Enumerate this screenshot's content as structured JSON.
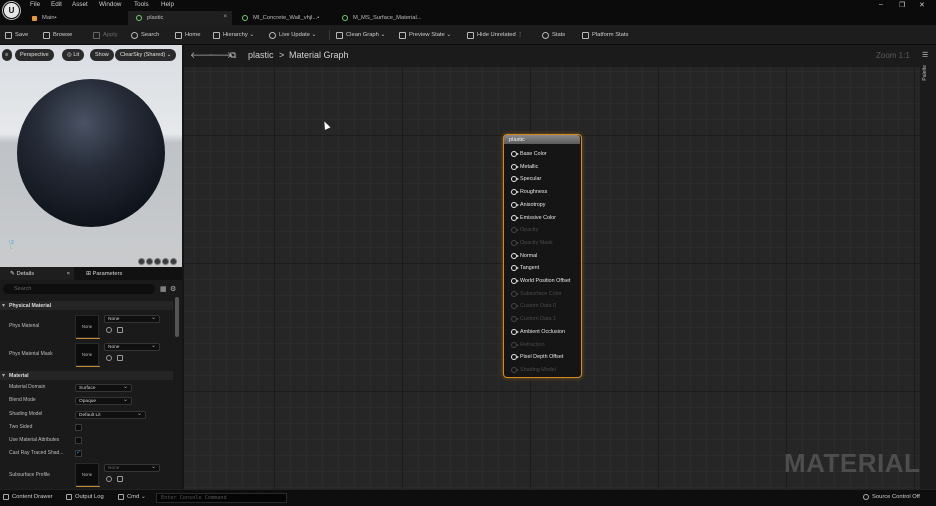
{
  "menu": {
    "items": [
      "File",
      "Edit",
      "Asset",
      "Window",
      "Tools",
      "Help"
    ],
    "window_controls": [
      "–",
      "❐",
      "✕"
    ]
  },
  "tabs": [
    {
      "label": "Main•",
      "icon": "level-icon"
    },
    {
      "label": "plastic",
      "icon": "material-icon",
      "close": "×"
    },
    {
      "label": "MI_Concrete_Wall_vhjl...•",
      "icon": "material-instance-icon"
    },
    {
      "label": "M_MS_Surface_Material...",
      "icon": "material-icon"
    }
  ],
  "toolbar": {
    "save": "Save",
    "browse": "Browse",
    "apply": "Apply",
    "search": "Search",
    "home": "Home",
    "hierarchy": "Hierarchy",
    "live_update": "Live Update",
    "clean_graph": "Clean Graph",
    "preview_state": "Preview State",
    "hide_unrelated": "Hide Unrelated",
    "stats": "Stats",
    "platform_stats": "Platform Stats"
  },
  "viewport": {
    "perspective": "Perspective",
    "lit": "Lit",
    "show": "Show",
    "sky": "ClearSky (Shared)"
  },
  "details": {
    "tab_details": "Details",
    "tab_close": "×",
    "tab_parameters": "Parameters",
    "search_placeholder": "Search",
    "section_physical": "Physical Material",
    "phys_material_label": "Phys Material",
    "phys_material_value": "None",
    "phys_material_thumb": "None",
    "phys_mask_label": "Phys Material Mask",
    "phys_mask_value": "None",
    "phys_mask_thumb": "None",
    "section_material": "Material",
    "material_domain_label": "Material Domain",
    "material_domain_value": "Surface",
    "blend_mode_label": "Blend Mode",
    "blend_mode_value": "Opaque",
    "shading_model_label": "Shading Model",
    "shading_model_value": "Default Lit",
    "two_sided_label": "Two Sided",
    "use_material_attributes_label": "Use Material Attributes",
    "cast_ray_traced_label": "Cast Ray Traced Shad...",
    "subsurface_profile_label": "Subsurface Profile",
    "subsurface_profile_value": "None",
    "subsurface_thumb": "None"
  },
  "graph": {
    "breadcrumb_asset": "plastic",
    "breadcrumb_sep": ">",
    "breadcrumb_graph": "Material Graph",
    "zoom": "Zoom 1:1",
    "watermark": "MATERIAL",
    "palette": "Palette"
  },
  "node": {
    "title": "plastic",
    "pins": [
      {
        "label": "Base Color",
        "enabled": true
      },
      {
        "label": "Metallic",
        "enabled": true
      },
      {
        "label": "Specular",
        "enabled": true
      },
      {
        "label": "Roughness",
        "enabled": true
      },
      {
        "label": "Anisotropy",
        "enabled": true
      },
      {
        "label": "Emissive Color",
        "enabled": true
      },
      {
        "label": "Opacity",
        "enabled": false
      },
      {
        "label": "Opacity Mask",
        "enabled": false
      },
      {
        "label": "Normal",
        "enabled": true
      },
      {
        "label": "Tangent",
        "enabled": true
      },
      {
        "label": "World Position Offset",
        "enabled": true
      },
      {
        "label": "Subsurface Color",
        "enabled": false
      },
      {
        "label": "Custom Data 0",
        "enabled": false
      },
      {
        "label": "Custom Data 1",
        "enabled": false
      },
      {
        "label": "Ambient Occlusion",
        "enabled": true
      },
      {
        "label": "Refraction",
        "enabled": false
      },
      {
        "label": "Pixel Depth Offset",
        "enabled": true
      },
      {
        "label": "Shading Model",
        "enabled": false
      }
    ]
  },
  "statusbar": {
    "content_drawer": "Content Drawer",
    "output_log": "Output Log",
    "cmd": "Cmd",
    "console_placeholder": "Enter Console Command",
    "source_control": "Source Control Off"
  },
  "colors": {
    "node_border": "#d78a1a",
    "accent_blue": "#3a8fe0"
  }
}
